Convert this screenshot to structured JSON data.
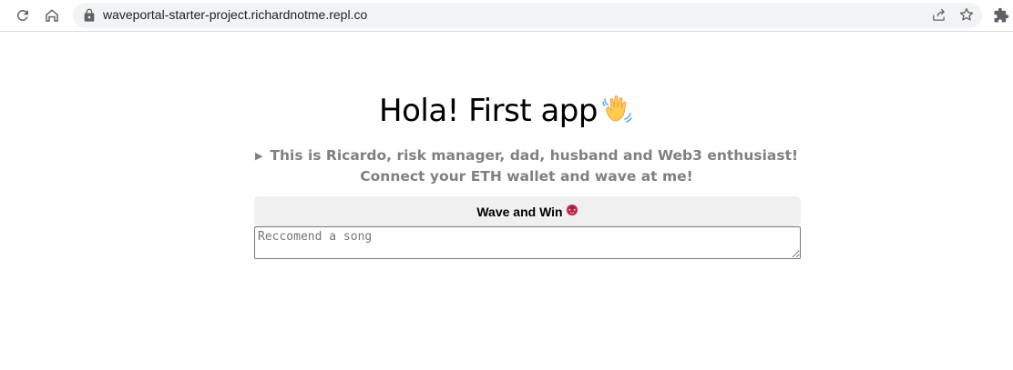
{
  "browser": {
    "url": "waveportal-starter-project.richardnotme.repl.co",
    "icons": {
      "reload": "reload-icon",
      "home": "home-icon",
      "lock": "lock-icon",
      "share": "share-icon",
      "bookmark": "star-icon",
      "extensions": "puzzle-icon"
    }
  },
  "page": {
    "title": "Hola! First app",
    "title_emoji": "👋",
    "bio": "This is Ricardo, risk manager, dad, husband and Web3 enthusiast! Connect your ETH wallet and wave at me!",
    "wave_button_label": "Wave and Win",
    "wave_button_emoji": "🤩",
    "song_input_placeholder": "Reccomend a song",
    "song_input_value": ""
  },
  "colors": {
    "bio_text": "#808080",
    "button_bg": "#f0f0f0",
    "omnibox_bg": "#f1f3f4"
  }
}
